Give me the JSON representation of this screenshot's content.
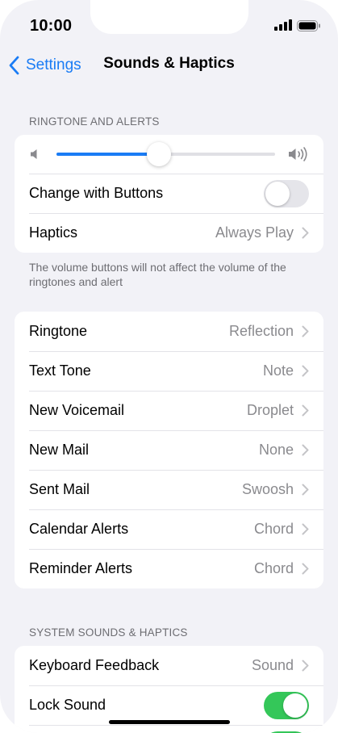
{
  "status": {
    "time": "10:00"
  },
  "nav": {
    "back_label": "Settings",
    "title": "Sounds & Haptics"
  },
  "ringtone_section": {
    "header": "RINGTONE AND ALERTS",
    "volume_level": 0.47,
    "change_with_buttons": {
      "label": "Change with Buttons",
      "on": false
    },
    "haptics": {
      "label": "Haptics",
      "value": "Always Play"
    },
    "footnote": "The volume buttons will not affect the volume of the ringtones and alert"
  },
  "tones": [
    {
      "label": "Ringtone",
      "value": "Reflection"
    },
    {
      "label": "Text Tone",
      "value": "Note"
    },
    {
      "label": "New Voicemail",
      "value": "Droplet"
    },
    {
      "label": "New Mail",
      "value": "None"
    },
    {
      "label": "Sent Mail",
      "value": "Swoosh"
    },
    {
      "label": "Calendar Alerts",
      "value": "Chord"
    },
    {
      "label": "Reminder Alerts",
      "value": "Chord"
    }
  ],
  "system_section": {
    "header": "SYSTEM SOUNDS & HAPTICS",
    "keyboard_feedback": {
      "label": "Keyboard Feedback",
      "value": "Sound"
    },
    "lock_sound": {
      "label": "Lock Sound",
      "on": true
    }
  },
  "colors": {
    "accent": "#1a7cf5",
    "toggle_on": "#34c759",
    "background": "#f2f2f7"
  }
}
